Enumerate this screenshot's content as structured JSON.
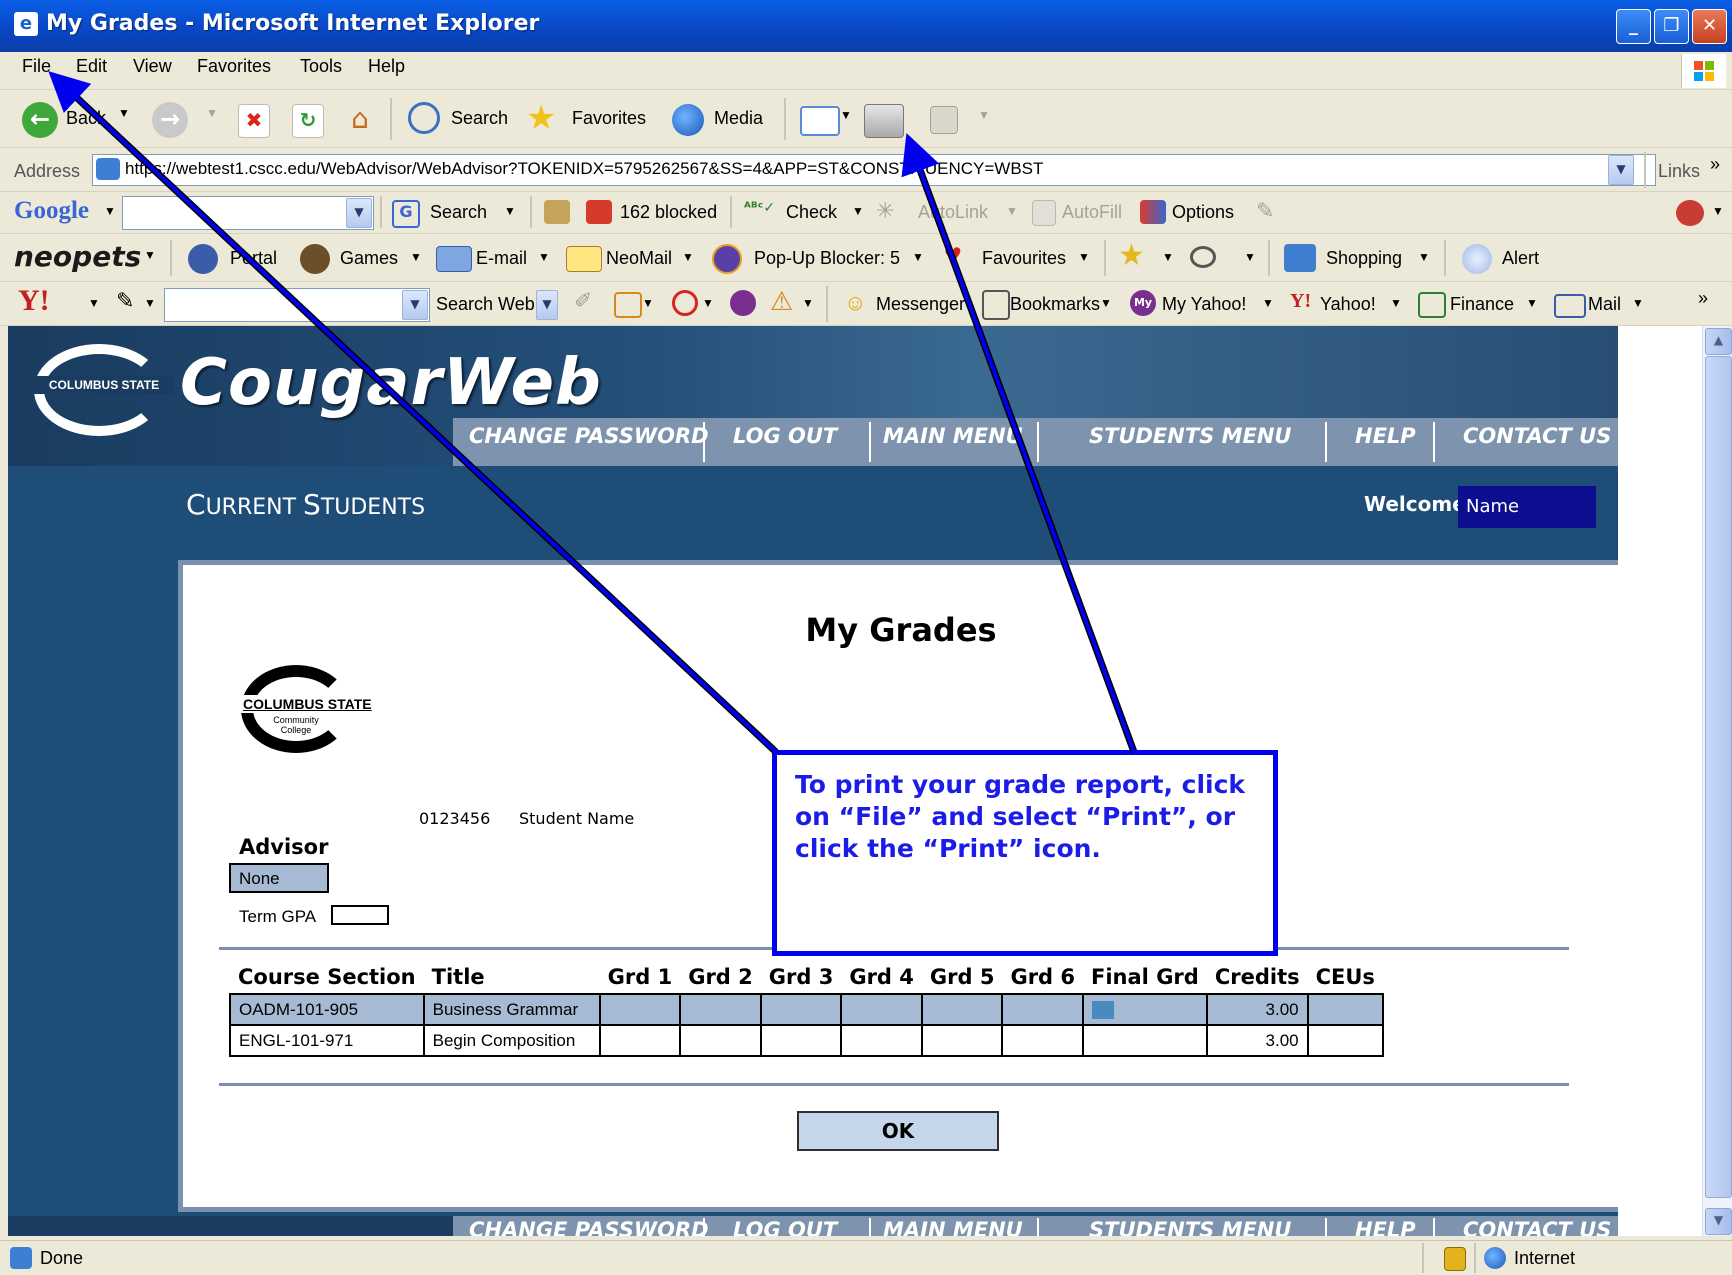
{
  "window": {
    "title": "My Grades - Microsoft Internet Explorer"
  },
  "menu": [
    "File",
    "Edit",
    "View",
    "Favorites",
    "Tools",
    "Help"
  ],
  "toolbar": {
    "back": "Back",
    "search": "Search",
    "favorites": "Favorites",
    "media": "Media"
  },
  "address": {
    "label": "Address",
    "url": "https://webtest1.cscc.edu/WebAdvisor/WebAdvisor?TOKENIDX=5795262567&SS=4&APP=ST&CONSTITUENCY=WBST",
    "links": "Links"
  },
  "google": {
    "brand": "Google",
    "search": "Search",
    "blocked": "162 blocked",
    "check": "Check",
    "autolink": "AutoLink",
    "autofill": "AutoFill",
    "options": "Options"
  },
  "neopets": {
    "brand": "neopets",
    "portal": "Portal",
    "games": "Games",
    "email": "E-mail",
    "neomail": "NeoMail",
    "popup": "Pop-Up Blocker: 5",
    "favourites": "Favourites",
    "shopping": "Shopping",
    "alert": "Alert"
  },
  "yahoo": {
    "brand": "Y!",
    "searchweb": "Search Web",
    "messenger": "Messenger",
    "bookmarks": "Bookmarks",
    "myyahoo": "My Yahoo!",
    "yahoo": "Yahoo!",
    "finance": "Finance",
    "mail": "Mail"
  },
  "site": {
    "logo_small": "COLUMBUS STATE",
    "logo_sub": "Community College",
    "brand": "CougarWeb",
    "nav": [
      "CHANGE PASSWORD",
      "LOG OUT",
      "MAIN MENU",
      "STUDENTS MENU",
      "HELP",
      "CONTACT US"
    ],
    "section_first_C": "C",
    "section_rest1": "URRENT ",
    "section_first_S": "S",
    "section_rest2": "TUDENTS",
    "welcome": "Welcome",
    "welcome_name": "Name"
  },
  "grades": {
    "title": "My Grades",
    "logo": "COLUMBUS STATE",
    "logo_sub": "Community College",
    "student_id": "0123456",
    "student_name": "Student Name",
    "advisor_label": "Advisor",
    "advisor_value": "None",
    "term_gpa_label": "Term GPA",
    "columns": [
      "Course Section",
      "Title",
      "Grd 1",
      "Grd 2",
      "Grd 3",
      "Grd 4",
      "Grd 5",
      "Grd 6",
      "Final Grd",
      "Credits",
      "CEUs"
    ],
    "rows": [
      [
        "OADM-101-905",
        "Business Grammar",
        "",
        "",
        "",
        "",
        "",
        "",
        "",
        "3.00",
        ""
      ],
      [
        "ENGL-101-971",
        "Begin Composition",
        "",
        "",
        "",
        "",
        "",
        "",
        "",
        "3.00",
        ""
      ]
    ],
    "ok": "OK"
  },
  "callout": "To print your grade report, click on “File” and select “Print”, or click the “Print” icon.",
  "status": {
    "left": "Done",
    "zone": "Internet"
  },
  "colors": {
    "titlebar": "#0A5FE6",
    "page_bg": "#1E4D77",
    "callout": "#0000EE"
  }
}
